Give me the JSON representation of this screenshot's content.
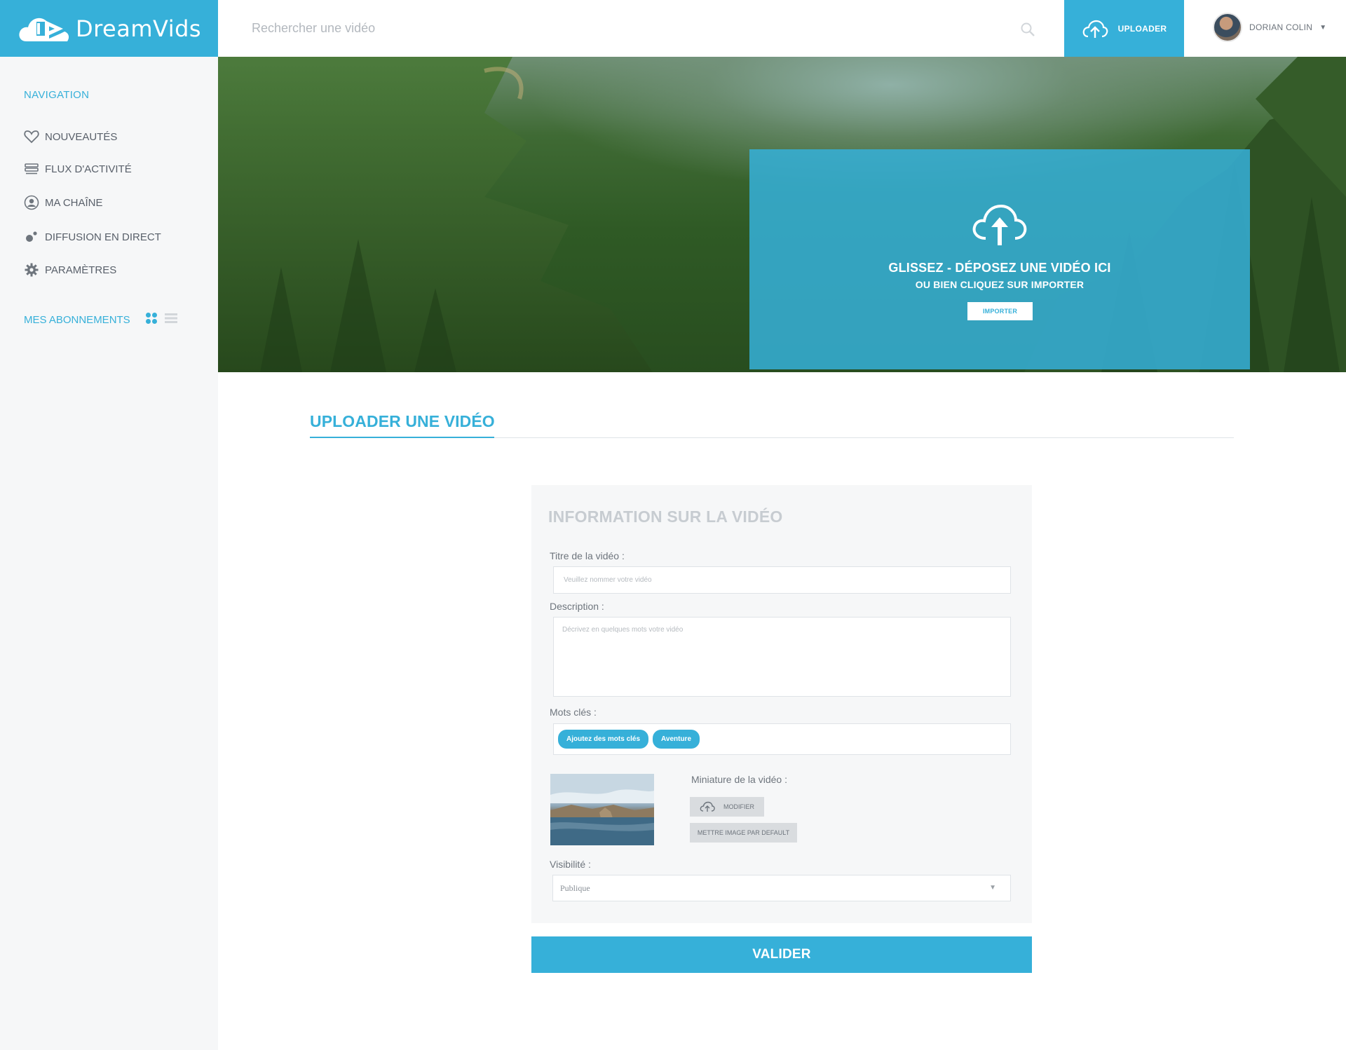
{
  "brand": {
    "name_light": "Dream",
    "name_bold": "Vids",
    "accent": "#36b0d9"
  },
  "header": {
    "search_placeholder": "Rechercher une vidéo",
    "upload_label": "UPLOADER",
    "user_name": "DORIAN COLIN",
    "user_caret": "▼"
  },
  "sidebar": {
    "nav_title": "NAVIGATION",
    "items": [
      {
        "label": "NOUVEAUTÉS",
        "icon": "heart-icon"
      },
      {
        "label": "FLUX D'ACTIVITÉ",
        "icon": "stack-icon"
      },
      {
        "label": "MA CHAÎNE",
        "icon": "user-circle-icon"
      },
      {
        "label": "DIFFUSION EN DIRECT",
        "icon": "live-icon"
      },
      {
        "label": "PARAMÈTRES",
        "icon": "gear-icon"
      }
    ],
    "subscriptions_title": "MES ABONNEMENTS"
  },
  "hero": {
    "drop_title": "GLISSEZ - DÉPOSEZ UNE VIDÉO ICI",
    "drop_subtitle": "OU BIEN CLIQUEZ SUR IMPORTER",
    "import_label": "IMPORTER"
  },
  "section": {
    "title": "UPLOADER UNE VIDÉO"
  },
  "form": {
    "title": "INFORMATION SUR LA VIDÉO",
    "video_title_label": "Titre de la vidéo :",
    "video_title_placeholder": "Veuillez nommer votre vidéo",
    "description_label": "Description :",
    "description_placeholder": "Décrivez en quelques mots votre vidéo",
    "keywords_label": "Mots clés :",
    "tags": [
      "Ajoutez des mots clés",
      "Aventure"
    ],
    "thumbnail_label": "Miniature de la vidéo :",
    "modify_label": "MODIFIER",
    "default_image_label": "METTRE IMAGE PAR DEFAULT",
    "visibility_label": "Visibilité :",
    "visibility_value": "Publique",
    "select_caret": "▼",
    "submit_label": "VALIDER"
  }
}
